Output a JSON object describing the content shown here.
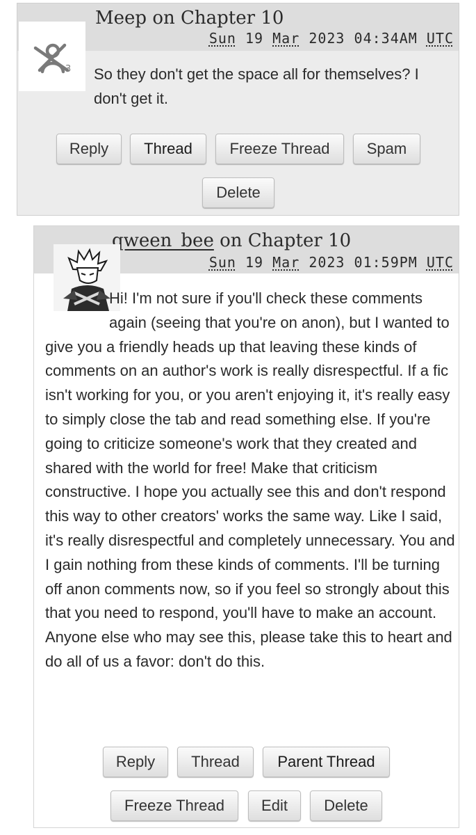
{
  "comments": [
    {
      "author": "Meep",
      "on_text": "on Chapter 10",
      "date": {
        "weekday": "Sun",
        "day": "19",
        "month": "Mar",
        "year": "2023",
        "time": "04:34AM",
        "tz": "UTC"
      },
      "avatar_icon": "anonymous-user-icon",
      "body": "So they don't get the space all for themselves? I don't get it.",
      "buttons": {
        "reply": "Reply",
        "thread": "Thread",
        "freeze_thread": "Freeze Thread",
        "spam": "Spam",
        "delete": "Delete"
      }
    },
    {
      "author": "qween_bee",
      "on_text": "on Chapter 10",
      "date": {
        "weekday": "Sun",
        "day": "19",
        "month": "Mar",
        "year": "2023",
        "time": "01:59PM",
        "tz": "UTC"
      },
      "avatar_icon": "user-avatar-illustration",
      "body": "Hi! I'm not sure if you'll check these comments again (seeing that you're on anon), but I wanted to give you a friendly heads up that leaving these kinds of comments on an author's work is really disrespectful. If a fic isn't working for you, or you aren't enjoying it, it's really easy to simply close the tab and read something else. If you're going to criticize someone's work that they created and shared with the world for free! Make that criticism constructive. I hope you actually see this and don't respond this way to other creators' works the same way. Like I said, it's really disrespectful and completely unnecessary. You and I gain nothing from these kinds of comments. I'll be turning off anon comments now, so if you feel so strongly about this that you need to respond, you'll have to make an account. Anyone else who may see this, please take this to heart and do all of us a favor: don't do this.",
      "buttons": {
        "reply": "Reply",
        "thread": "Thread",
        "parent_thread": "Parent Thread",
        "freeze_thread": "Freeze Thread",
        "edit": "Edit",
        "delete": "Delete"
      }
    }
  ],
  "colors": {
    "anon_comment_bg": "#ececec",
    "header_band": "#dddddd",
    "text": "#2a2a2a",
    "button_border": "#bdbdbd"
  }
}
